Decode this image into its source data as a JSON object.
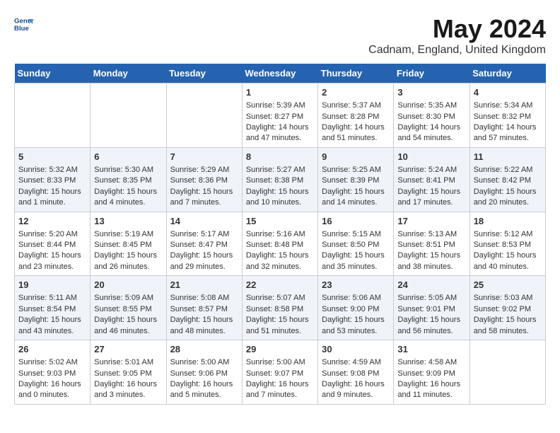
{
  "header": {
    "logo_line1": "General",
    "logo_line2": "Blue",
    "title": "May 2024",
    "subtitle": "Cadnam, England, United Kingdom"
  },
  "days_of_week": [
    "Sunday",
    "Monday",
    "Tuesday",
    "Wednesday",
    "Thursday",
    "Friday",
    "Saturday"
  ],
  "weeks": [
    [
      {
        "day": "",
        "info": ""
      },
      {
        "day": "",
        "info": ""
      },
      {
        "day": "",
        "info": ""
      },
      {
        "day": "1",
        "info": "Sunrise: 5:39 AM\nSunset: 8:27 PM\nDaylight: 14 hours\nand 47 minutes."
      },
      {
        "day": "2",
        "info": "Sunrise: 5:37 AM\nSunset: 8:28 PM\nDaylight: 14 hours\nand 51 minutes."
      },
      {
        "day": "3",
        "info": "Sunrise: 5:35 AM\nSunset: 8:30 PM\nDaylight: 14 hours\nand 54 minutes."
      },
      {
        "day": "4",
        "info": "Sunrise: 5:34 AM\nSunset: 8:32 PM\nDaylight: 14 hours\nand 57 minutes."
      }
    ],
    [
      {
        "day": "5",
        "info": "Sunrise: 5:32 AM\nSunset: 8:33 PM\nDaylight: 15 hours\nand 1 minute."
      },
      {
        "day": "6",
        "info": "Sunrise: 5:30 AM\nSunset: 8:35 PM\nDaylight: 15 hours\nand 4 minutes."
      },
      {
        "day": "7",
        "info": "Sunrise: 5:29 AM\nSunset: 8:36 PM\nDaylight: 15 hours\nand 7 minutes."
      },
      {
        "day": "8",
        "info": "Sunrise: 5:27 AM\nSunset: 8:38 PM\nDaylight: 15 hours\nand 10 minutes."
      },
      {
        "day": "9",
        "info": "Sunrise: 5:25 AM\nSunset: 8:39 PM\nDaylight: 15 hours\nand 14 minutes."
      },
      {
        "day": "10",
        "info": "Sunrise: 5:24 AM\nSunset: 8:41 PM\nDaylight: 15 hours\nand 17 minutes."
      },
      {
        "day": "11",
        "info": "Sunrise: 5:22 AM\nSunset: 8:42 PM\nDaylight: 15 hours\nand 20 minutes."
      }
    ],
    [
      {
        "day": "12",
        "info": "Sunrise: 5:20 AM\nSunset: 8:44 PM\nDaylight: 15 hours\nand 23 minutes."
      },
      {
        "day": "13",
        "info": "Sunrise: 5:19 AM\nSunset: 8:45 PM\nDaylight: 15 hours\nand 26 minutes."
      },
      {
        "day": "14",
        "info": "Sunrise: 5:17 AM\nSunset: 8:47 PM\nDaylight: 15 hours\nand 29 minutes."
      },
      {
        "day": "15",
        "info": "Sunrise: 5:16 AM\nSunset: 8:48 PM\nDaylight: 15 hours\nand 32 minutes."
      },
      {
        "day": "16",
        "info": "Sunrise: 5:15 AM\nSunset: 8:50 PM\nDaylight: 15 hours\nand 35 minutes."
      },
      {
        "day": "17",
        "info": "Sunrise: 5:13 AM\nSunset: 8:51 PM\nDaylight: 15 hours\nand 38 minutes."
      },
      {
        "day": "18",
        "info": "Sunrise: 5:12 AM\nSunset: 8:53 PM\nDaylight: 15 hours\nand 40 minutes."
      }
    ],
    [
      {
        "day": "19",
        "info": "Sunrise: 5:11 AM\nSunset: 8:54 PM\nDaylight: 15 hours\nand 43 minutes."
      },
      {
        "day": "20",
        "info": "Sunrise: 5:09 AM\nSunset: 8:55 PM\nDaylight: 15 hours\nand 46 minutes."
      },
      {
        "day": "21",
        "info": "Sunrise: 5:08 AM\nSunset: 8:57 PM\nDaylight: 15 hours\nand 48 minutes."
      },
      {
        "day": "22",
        "info": "Sunrise: 5:07 AM\nSunset: 8:58 PM\nDaylight: 15 hours\nand 51 minutes."
      },
      {
        "day": "23",
        "info": "Sunrise: 5:06 AM\nSunset: 9:00 PM\nDaylight: 15 hours\nand 53 minutes."
      },
      {
        "day": "24",
        "info": "Sunrise: 5:05 AM\nSunset: 9:01 PM\nDaylight: 15 hours\nand 56 minutes."
      },
      {
        "day": "25",
        "info": "Sunrise: 5:03 AM\nSunset: 9:02 PM\nDaylight: 15 hours\nand 58 minutes."
      }
    ],
    [
      {
        "day": "26",
        "info": "Sunrise: 5:02 AM\nSunset: 9:03 PM\nDaylight: 16 hours\nand 0 minutes."
      },
      {
        "day": "27",
        "info": "Sunrise: 5:01 AM\nSunset: 9:05 PM\nDaylight: 16 hours\nand 3 minutes."
      },
      {
        "day": "28",
        "info": "Sunrise: 5:00 AM\nSunset: 9:06 PM\nDaylight: 16 hours\nand 5 minutes."
      },
      {
        "day": "29",
        "info": "Sunrise: 5:00 AM\nSunset: 9:07 PM\nDaylight: 16 hours\nand 7 minutes."
      },
      {
        "day": "30",
        "info": "Sunrise: 4:59 AM\nSunset: 9:08 PM\nDaylight: 16 hours\nand 9 minutes."
      },
      {
        "day": "31",
        "info": "Sunrise: 4:58 AM\nSunset: 9:09 PM\nDaylight: 16 hours\nand 11 minutes."
      },
      {
        "day": "",
        "info": ""
      }
    ]
  ]
}
